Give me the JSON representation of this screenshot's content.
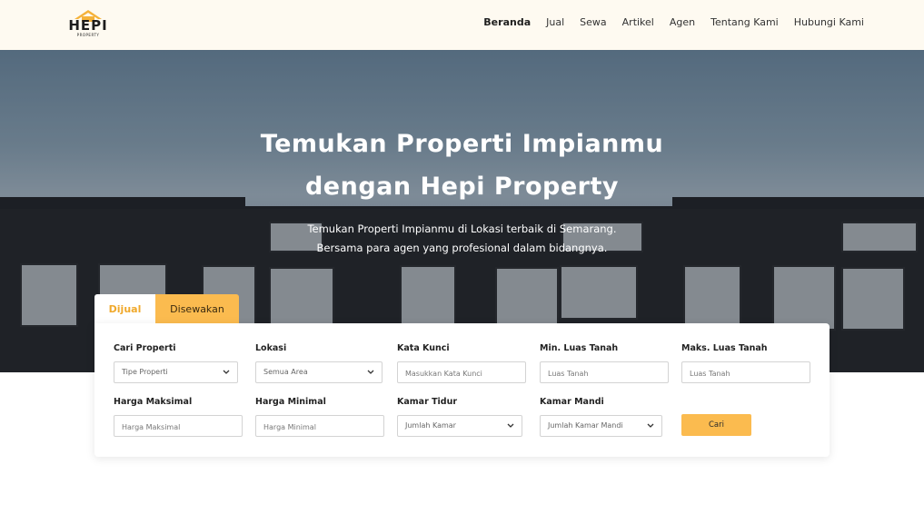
{
  "brand": {
    "logo_text": "HEPI",
    "logo_sub": "PROPERTY"
  },
  "nav": {
    "items": [
      {
        "label": "Beranda",
        "active": true
      },
      {
        "label": "Jual",
        "active": false
      },
      {
        "label": "Sewa",
        "active": false
      },
      {
        "label": "Artikel",
        "active": false
      },
      {
        "label": "Agen",
        "active": false
      },
      {
        "label": "Tentang Kami",
        "active": false
      },
      {
        "label": "Hubungi Kami",
        "active": false
      }
    ]
  },
  "hero": {
    "title_line1": "Temukan Properti Impianmu",
    "title_line2": "dengan Hepi Property",
    "subtitle_line1": "Temukan Properti Impianmu di Lokasi terbaik di Semarang.",
    "subtitle_line2": "Bersama para agen yang profesional dalam bidangnya."
  },
  "search": {
    "tabs": [
      {
        "label": "Dijual",
        "active": true
      },
      {
        "label": "Disewakan",
        "active": false
      }
    ],
    "fields": {
      "cari_properti": {
        "label": "Cari Properti",
        "value": "Tipe Properti"
      },
      "lokasi": {
        "label": "Lokasi",
        "value": "Semua Area"
      },
      "kata_kunci": {
        "label": "Kata Kunci",
        "placeholder": "Masukkan Kata Kunci"
      },
      "min_luas": {
        "label": "Min. Luas Tanah",
        "placeholder": "Luas Tanah"
      },
      "maks_luas": {
        "label": "Maks. Luas Tanah",
        "placeholder": "Luas Tanah"
      },
      "harga_maks": {
        "label": "Harga Maksimal",
        "placeholder": "Harga Maksimal"
      },
      "harga_min": {
        "label": "Harga Minimal",
        "placeholder": "Harga Minimal"
      },
      "kamar_tidur": {
        "label": "Kamar Tidur",
        "value": "Jumlah Kamar"
      },
      "kamar_mandi": {
        "label": "Kamar Mandi",
        "value": "Jumlah Kamar Mandi"
      }
    },
    "submit_label": "Cari"
  },
  "colors": {
    "accent": "#fbbb4f",
    "accent_text": "#f0a92c",
    "navbar_bg": "#fefaf1"
  }
}
